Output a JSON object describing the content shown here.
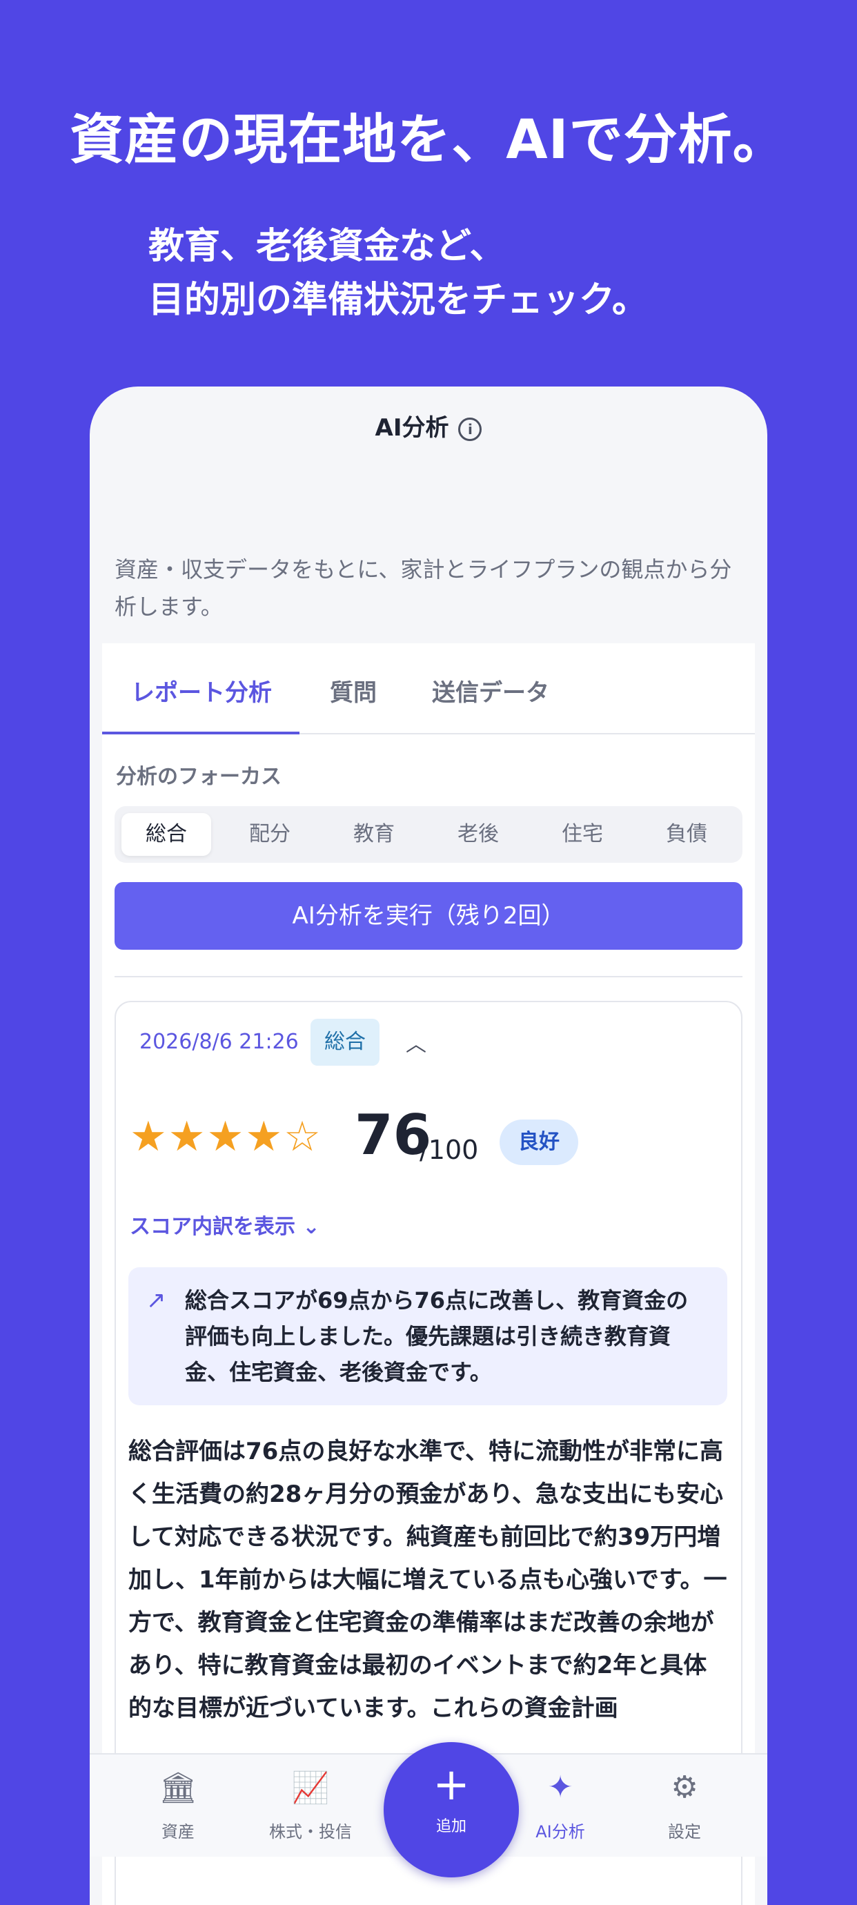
{
  "promo": {
    "headline": "資産の現在地を、AIで分析。",
    "sub_line1": "教育、老後資金など、",
    "sub_line2": "目的別の準備状況をチェック。"
  },
  "screen": {
    "title": "AI分析",
    "intro": "資産・収支データをもとに、家計とライフプランの観点から分析します。"
  },
  "tabs": [
    {
      "label": "レポート分析"
    },
    {
      "label": "質問"
    },
    {
      "label": "送信データ"
    }
  ],
  "focus": {
    "label": "分析のフォーカス",
    "options": [
      "総合",
      "配分",
      "教育",
      "老後",
      "住宅",
      "負債"
    ],
    "selected": "総合"
  },
  "run_button": "AI分析を実行（残り2回）",
  "result": {
    "datetime": "2026/8/6 21:26",
    "badge": "総合",
    "stars": "★★★★☆",
    "rating": 4,
    "score": "76",
    "score_max": "/100",
    "grade": "良好",
    "breakdown_link": "スコア内訳を表示",
    "summary": "総合スコアが69点から76点に改善し、教育資金の評価も向上しました。優先課題は引き続き教育資金、住宅資金、老後資金です。",
    "body": "総合評価は76点の良好な水準で、特に流動性が非常に高く生活費の約28ヶ月分の預金があり、急な支出にも安心して対応できる状況です。純資産も前回比で約39万円増加し、1年前からは大幅に増えている点も心強いです。一方で、教育資金と住宅資金の準備率はまだ改善の余地があり、特に教育資金は最初のイベントまで約2年と具体的な目標が近づいています。これらの資金計画"
  },
  "bottom_nav": [
    {
      "label": "資産",
      "icon": "bank-icon"
    },
    {
      "label": "株式・投信",
      "icon": "chart-icon"
    },
    {
      "label": "AI分析",
      "icon": "sparkle-icon"
    },
    {
      "label": "設定",
      "icon": "gear-icon"
    }
  ],
  "fab": {
    "label": "追加"
  },
  "colors": {
    "brand": "#5046e5",
    "accent": "#5b56e0",
    "star": "#f5a021"
  }
}
